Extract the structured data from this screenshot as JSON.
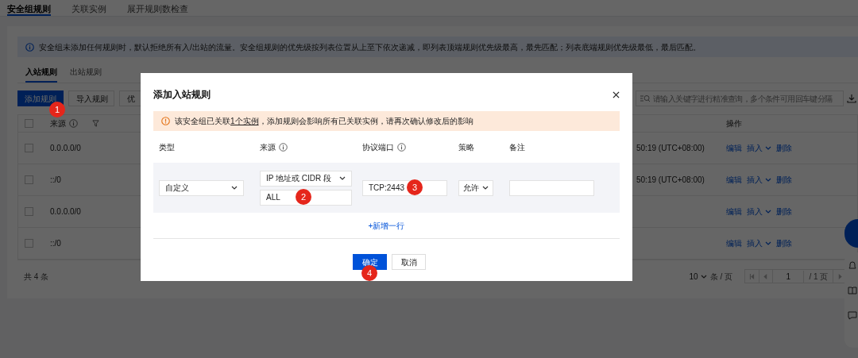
{
  "page_tabs": [
    {
      "label": "安全组规则",
      "selected": true
    },
    {
      "label": "关联实例",
      "selected": false
    },
    {
      "label": "展开规则数检查",
      "selected": false
    }
  ],
  "info_banner": "安全组未添加任何规则时，默认拒绝所有入/出站的流量。安全组规则的优先级按列表位置从上至下依次递减，即列表顶端规则优先级最高，最先匹配；列表底端规则优先级最低，最后匹配。",
  "rule_tabs": [
    {
      "label": "入站规则",
      "selected": true
    },
    {
      "label": "出站规则",
      "selected": false
    }
  ],
  "toolbar": {
    "buttons": [
      {
        "label": "添加规则",
        "kind": "primary"
      },
      {
        "label": "导入规则",
        "kind": "default"
      },
      {
        "label": "优",
        "kind": "default"
      }
    ],
    "search": {
      "placeholder": "请输入关键字进行精准查询，多个条件可用回车键分隔"
    }
  },
  "table": {
    "header_checked": false,
    "columns": [
      {
        "label": "来源",
        "info": true,
        "filter": true
      },
      {
        "label": "操作",
        "info": false,
        "filter": false
      }
    ],
    "rows": [
      {
        "checked": false,
        "source": "0.0.0.0/0",
        "time": "50:19 (UTC+08:00)",
        "actions": [
          {
            "label": "编辑",
            "dropdown": false
          },
          {
            "label": "插入",
            "dropdown": true
          },
          {
            "label": "删除",
            "dropdown": false
          }
        ]
      },
      {
        "checked": false,
        "source": "::/0",
        "time": "50:19 (UTC+08:00)",
        "actions": [
          {
            "label": "编辑",
            "dropdown": false
          },
          {
            "label": "插入",
            "dropdown": true
          },
          {
            "label": "删除",
            "dropdown": false
          }
        ]
      },
      {
        "checked": false,
        "source": "0.0.0.0/0",
        "actions": [
          {
            "label": "编辑",
            "dropdown": false
          },
          {
            "label": "插入",
            "dropdown": true
          },
          {
            "label": "删除",
            "dropdown": false
          }
        ]
      },
      {
        "checked": false,
        "source": "::/0",
        "actions": [
          {
            "label": "编辑",
            "dropdown": false
          },
          {
            "label": "插入",
            "dropdown": true
          },
          {
            "label": "删除",
            "dropdown": false
          }
        ]
      }
    ]
  },
  "footer": {
    "total": "共 4 条",
    "page_size": "10",
    "page_size_unit": "条 / 页",
    "page": "1",
    "page_count": "/ 1 页"
  },
  "dialog": {
    "title": "添加入站规则",
    "warning": {
      "before": "该安全组已关联",
      "link": "1个实例",
      "after": "，添加规则会影响所有已关联实例，请再次确认修改后的影响"
    },
    "columns": [
      {
        "label": "类型",
        "info": false
      },
      {
        "label": "来源",
        "info": true
      },
      {
        "label": "协议端口",
        "info": true
      },
      {
        "label": "策略",
        "info": false
      },
      {
        "label": "备注",
        "info": false
      }
    ],
    "row": {
      "type": "自定义",
      "source_type": "IP 地址或 CIDR 段",
      "source": "ALL",
      "port": "TCP:2443",
      "policy": "允许"
    },
    "add_row": "+新增一行",
    "buttons": [
      {
        "label": "确定",
        "kind": "primary"
      },
      {
        "label": "取消",
        "kind": "default"
      }
    ]
  },
  "annotations": [
    "1",
    "2",
    "3",
    "4"
  ]
}
